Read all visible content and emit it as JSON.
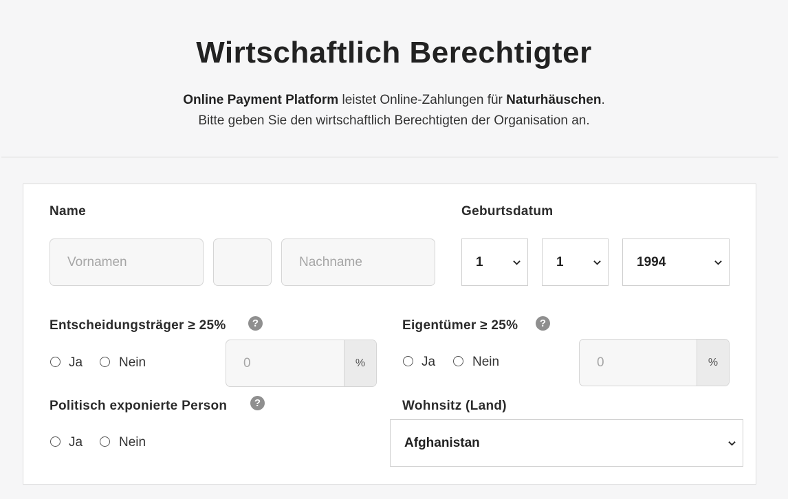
{
  "header": {
    "title": "Wirtschaftlich Berechtigter",
    "line1_bold1": "Online Payment Platform",
    "line1_mid": " leistet Online-Zahlungen für ",
    "line1_bold2": "Naturhäuschen",
    "line1_end": ".",
    "line2": "Bitte geben Sie den wirtschaftlich Berechtigten der Organisation an."
  },
  "form": {
    "name_label": "Name",
    "first_name_placeholder": "Vornamen",
    "middle_name_placeholder": "",
    "last_name_placeholder": "Nachname",
    "birthdate_label": "Geburtsdatum",
    "birth_day": "1",
    "birth_month": "1",
    "birth_year": "1994",
    "decision_maker_label": "Entscheidungsträger ≥ 25%",
    "owner_label": "Eigentümer ≥ 25%",
    "help_glyph": "?",
    "yes_label": "Ja",
    "no_label": "Nein",
    "decision_percent_placeholder": "0",
    "owner_percent_placeholder": "0",
    "percent_sign": "%",
    "pep_label": "Politisch exponierte Person",
    "residence_label": "Wohnsitz (Land)",
    "residence_country": "Afghanistan"
  },
  "icons": {
    "help": "question-circle-icon",
    "select": "chevron-down-icon"
  }
}
